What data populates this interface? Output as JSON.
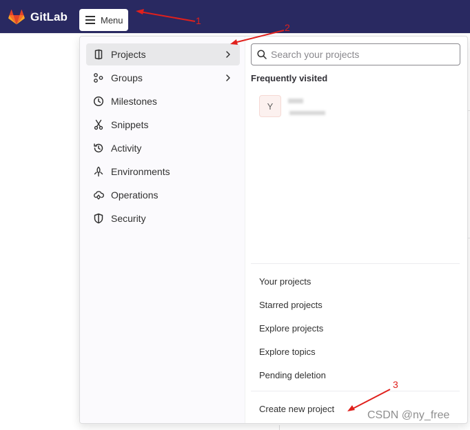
{
  "topbar": {
    "brand": "GitLab",
    "menu_label": "Menu",
    "colors": {
      "background": "#292961",
      "logo_primary": "#e24329",
      "logo_secondary": "#fc6d26"
    }
  },
  "nav": {
    "items": [
      {
        "label": "Projects",
        "icon": "project-icon",
        "has_submenu": true,
        "active": true
      },
      {
        "label": "Groups",
        "icon": "groups-icon",
        "has_submenu": true,
        "active": false
      },
      {
        "label": "Milestones",
        "icon": "clock-icon",
        "has_submenu": false,
        "active": false
      },
      {
        "label": "Snippets",
        "icon": "scissors-icon",
        "has_submenu": false,
        "active": false
      },
      {
        "label": "Activity",
        "icon": "history-icon",
        "has_submenu": false,
        "active": false
      },
      {
        "label": "Environments",
        "icon": "environment-icon",
        "has_submenu": false,
        "active": false
      },
      {
        "label": "Operations",
        "icon": "cloud-gear-icon",
        "has_submenu": false,
        "active": false
      },
      {
        "label": "Security",
        "icon": "shield-icon",
        "has_submenu": false,
        "active": false
      }
    ]
  },
  "projects_panel": {
    "search_placeholder": "Search your projects",
    "frequently_visited_title": "Frequently visited",
    "recent_project_avatar": "Y",
    "links": [
      "Your projects",
      "Starred projects",
      "Explore projects",
      "Explore topics",
      "Pending deletion"
    ],
    "create_link": "Create new project"
  },
  "annotations": {
    "one": "1",
    "two": "2",
    "three": "3",
    "color": "#e0201c"
  },
  "watermark": "CSDN @ny_free"
}
